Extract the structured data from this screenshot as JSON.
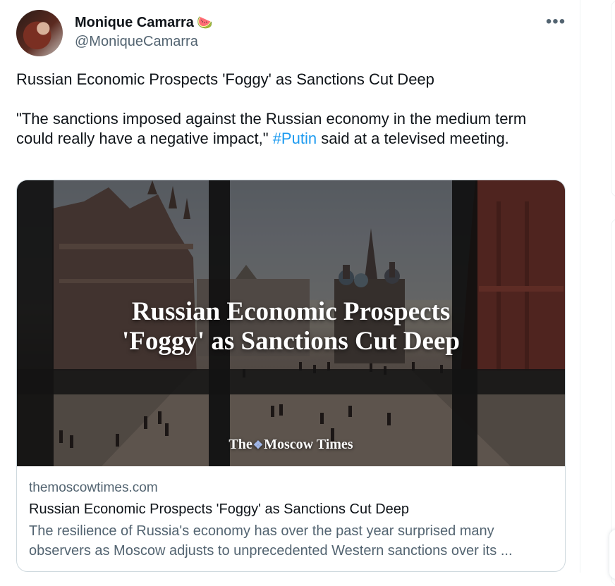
{
  "author": {
    "name": "Monique Camarra",
    "emoji": "🍉",
    "handle": "@MoniqueCamarra"
  },
  "menu": {
    "more_label": "•••"
  },
  "tweet": {
    "line1": "Russian Economic Prospects 'Foggy' as Sanctions Cut Deep",
    "quote_before": "\"The sanctions imposed against the Russian economy in the medium term could really have a negative impact,\" ",
    "hashtag": "#Putin",
    "quote_after": " said at a televised meeting."
  },
  "card": {
    "image_headline_line1": "Russian Economic Prospects",
    "image_headline_line2": "'Foggy' as Sanctions Cut Deep",
    "image_brand_the": "The",
    "image_brand_name": "Moscow Times",
    "domain": "themoscowtimes.com",
    "title": "Russian Economic Prospects 'Foggy' as Sanctions Cut Deep",
    "description": "The resilience of Russia's economy has over the past year surprised many observers as Moscow adjusts to unprecedented Western sanctions over its ..."
  },
  "colors": {
    "link": "#1d9bf0",
    "secondary_text": "#536471",
    "border": "#cfd9de"
  }
}
